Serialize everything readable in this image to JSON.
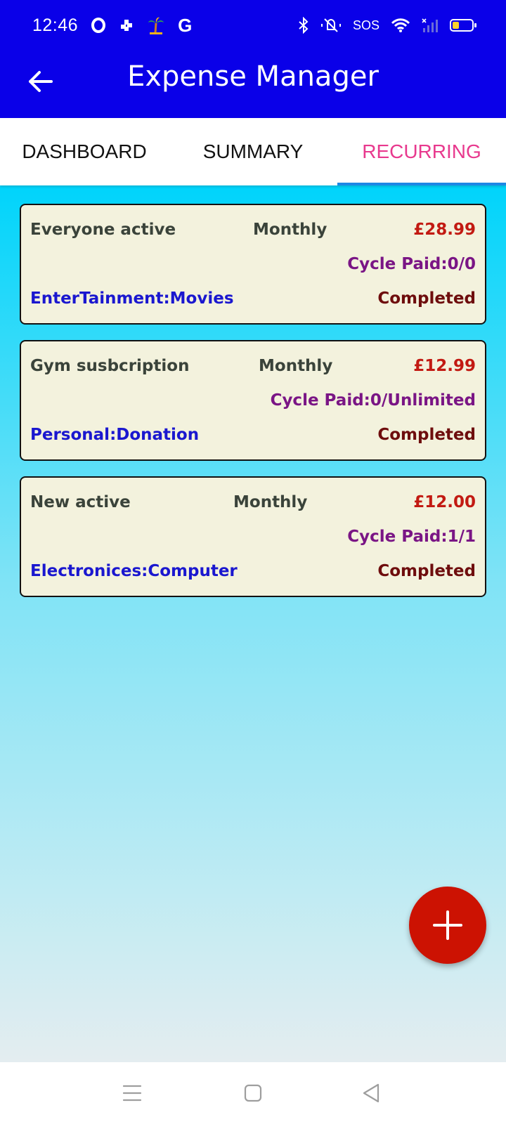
{
  "status_bar": {
    "time": "12:46",
    "sos": "SOS",
    "left_icons": [
      "opera-icon",
      "pinwheel-icon",
      "palm-tree-icon",
      "google-icon"
    ],
    "right_icons": [
      "bluetooth-icon",
      "mute-icon",
      "wifi-icon",
      "signal-icon",
      "battery-icon"
    ]
  },
  "app_bar": {
    "title": "Expense Manager",
    "back_icon": "arrow-left-icon",
    "background": "#0a00e8"
  },
  "tabs": [
    {
      "label": "DASHBOARD",
      "active": false
    },
    {
      "label": "SUMMARY",
      "active": false
    },
    {
      "label": "RECURRING",
      "active": true
    }
  ],
  "recurring": [
    {
      "name": "Everyone active",
      "frequency": "Monthly",
      "amount": "£28.99",
      "cycle": "Cycle Paid:0/0",
      "category": "EnterTainment:Movies",
      "status": "Completed"
    },
    {
      "name": "Gym susbcription",
      "frequency": "Monthly",
      "amount": "£12.99",
      "cycle": "Cycle Paid:0/Unlimited",
      "category": "Personal:Donation",
      "status": "Completed"
    },
    {
      "name": "New active",
      "frequency": "Monthly",
      "amount": "£12.00",
      "cycle": "Cycle Paid:1/1",
      "category": "Electronices:Computer",
      "status": "Completed"
    }
  ],
  "fab": {
    "icon": "plus-icon",
    "color": "#cc1202"
  },
  "nav_bar": {
    "icons": [
      "menu-icon",
      "home-icon",
      "back-icon"
    ]
  },
  "colors": {
    "tab_active": "#e8398e",
    "tab_indicator": "#1e88e5",
    "amount": "#c21a12",
    "cycle": "#7a1585",
    "category": "#1a17cf",
    "status": "#6e0d0d"
  }
}
